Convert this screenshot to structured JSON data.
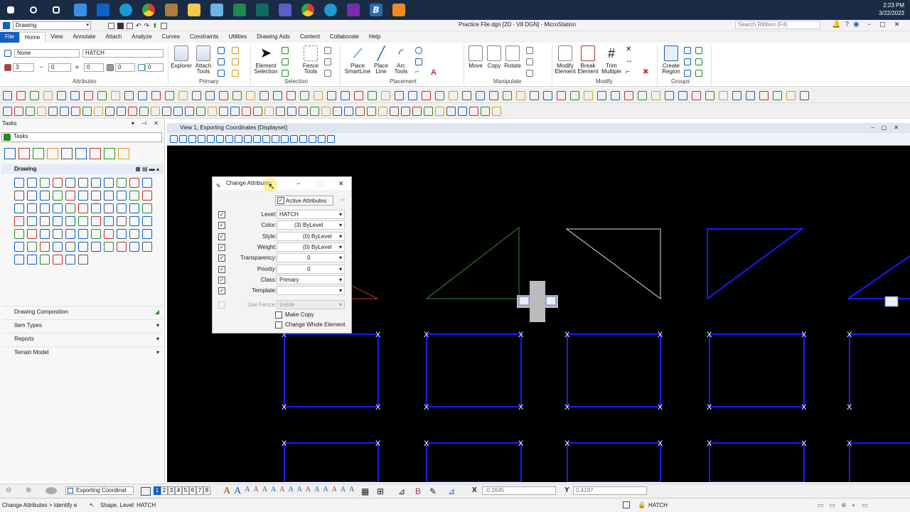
{
  "taskbar": {
    "icons": [
      "start-icon",
      "search-icon",
      "task-view-icon",
      "store-icon",
      "outlook-icon",
      "edge-icon",
      "chrome-icon",
      "app-icon",
      "files-icon",
      "app-icon-2",
      "excel-icon",
      "app-icon-3",
      "teams-icon",
      "chrome-icon-2",
      "edge-icon-2",
      "onenote-icon",
      "microstation-icon",
      "app-icon-4"
    ],
    "time": "2:23 PM",
    "date": "3/22/2023"
  },
  "window": {
    "title": "Practice File.dgn [2D - V8 DGN] - MicroStation",
    "workflow": "Drawing",
    "search_placeholder": "Search Ribbon (F4)"
  },
  "menu": [
    "File",
    "Home",
    "View",
    "Annotate",
    "Attach",
    "Analyze",
    "Curves",
    "Constraints",
    "Utilities",
    "Drawing Aids",
    "Content",
    "Collaborate",
    "Help"
  ],
  "ribbon": {
    "attributes": {
      "template": "None",
      "level": "HATCH",
      "color": "3",
      "style": "0",
      "weight": "0",
      "transparency": "0",
      "priority": "0",
      "label": "Attributes"
    },
    "primary": {
      "label": "Primary",
      "explorer": "Explorer",
      "attach_tools": "Attach\nTools"
    },
    "selection": {
      "label": "Selection",
      "element_selection": "Element\nSelection",
      "fence_tools": "Fence\nTools"
    },
    "placement": {
      "label": "Placement",
      "place_smartline": "Place\nSmartLine",
      "place_line": "Place\nLine",
      "arc_tools": "Arc\nTools"
    },
    "manipulate": {
      "label": "Manipulate",
      "move": "Move",
      "copy": "Copy",
      "rotate": "Rotate"
    },
    "modify": {
      "label": "Modify",
      "modify_element": "Modify\nElement",
      "break_element": "Break\nElement",
      "trim_multiple": "Trim\nMultiple"
    },
    "groups": {
      "label": "Groups",
      "create_region": "Create\nRegion"
    }
  },
  "tasks": {
    "header": "Tasks",
    "dropdown": "Tasks",
    "drawing": "Drawing",
    "sections": [
      "Drawing Composition",
      "Item Types",
      "Reports",
      "Terrain Model"
    ]
  },
  "view": {
    "title": "View 1, Exporting Coordinates [Displayset]"
  },
  "dialog": {
    "title": "Change Attributes",
    "active_attributes": "Active Attributes",
    "rows": [
      {
        "label": "Level:",
        "value": "HATCH"
      },
      {
        "label": "Color:",
        "value": "(3) ByLevel"
      },
      {
        "label": "Style:",
        "value": "(0) ByLevel"
      },
      {
        "label": "Weight:",
        "value": "(0) ByLevel"
      },
      {
        "label": "Transparency:",
        "value": "0"
      },
      {
        "label": "Priority:",
        "value": "0"
      },
      {
        "label": "Class:",
        "value": "Primary"
      },
      {
        "label": "Template:",
        "value": ""
      }
    ],
    "use_fence_label": "Use Fence:",
    "use_fence_value": "Inside",
    "make_copy": "Make Copy",
    "change_whole": "Change Whole Element"
  },
  "bottom": {
    "view_group": "Exporting Coordinat",
    "views": [
      "1",
      "2",
      "3",
      "4",
      "5",
      "6",
      "7",
      "8"
    ],
    "x_label": "X",
    "x_value": "-0.2645",
    "y_label": "Y",
    "y_value": "0.4197"
  },
  "status": {
    "prompt": "Change Attributes > Identify e",
    "message": "Shape, Level: HATCH",
    "level": "HATCH"
  },
  "colors": {
    "blue_shape": "#1a1aff",
    "green": "#2e8b2e",
    "white": "#dddddd",
    "red": "#c03030"
  }
}
